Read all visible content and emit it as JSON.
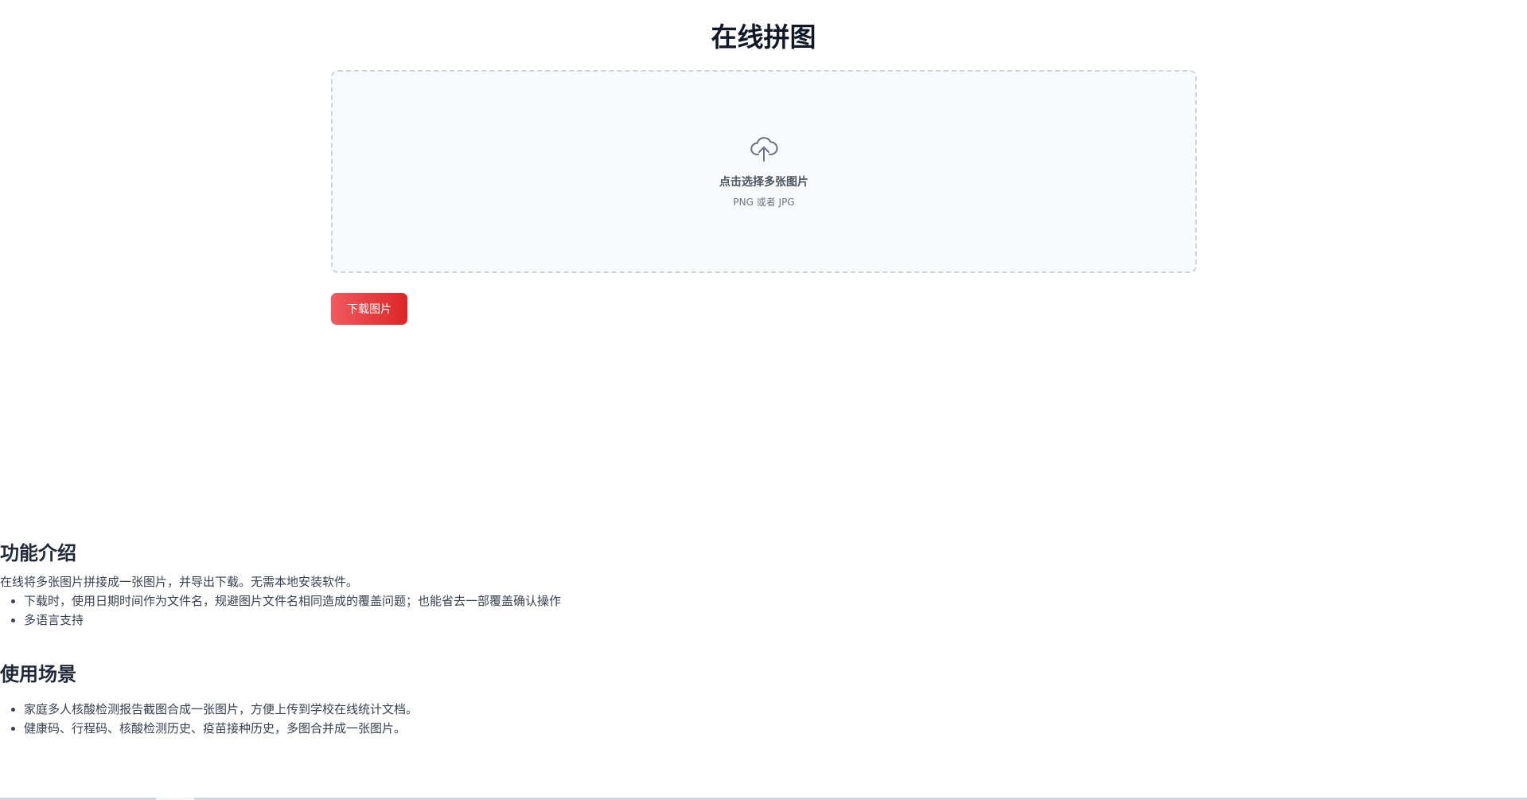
{
  "page": {
    "title": "在线拼图"
  },
  "upload": {
    "icon": "cloud-upload-icon",
    "label": "点击选择多张图片",
    "hint": "PNG 或者 JPG"
  },
  "actions": {
    "download_label": "下载图片"
  },
  "features": {
    "heading": "功能介绍",
    "intro": "在线将多张图片拼接成一张图片，并导出下载。无需本地安装软件。",
    "items": [
      "下载时，使用日期时间作为文件名，规避图片文件名相同造成的覆盖问题；也能省去一部覆盖确认操作",
      "多语言支持"
    ]
  },
  "scenarios": {
    "heading": "使用场景",
    "items": [
      "家庭多人核酸检测报告截图合成一张图片，方便上传到学校在线统计文档。",
      "健康码、行程码、核酸检测历史、疫苗接种历史，多图合并成一张图片。"
    ]
  },
  "colors": {
    "accent_start": "#f05a60",
    "accent_end": "#dc2626",
    "upload_border": "#cfd4dc",
    "upload_bg": "#f9fafb"
  }
}
